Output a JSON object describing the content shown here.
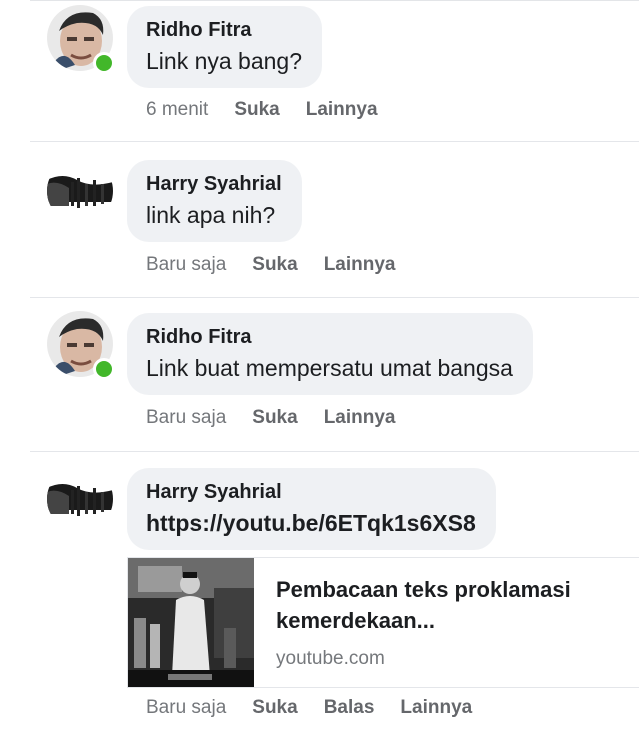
{
  "comments": [
    {
      "author": "Ridho Fitra",
      "text": "Link nya bang?",
      "time": "6 menit",
      "actions": [
        "Suka",
        "Lainnya"
      ],
      "avatar": "face-avatar",
      "online": true
    },
    {
      "author": "Harry Syahrial",
      "text": "link apa nih?",
      "time": "Baru saja",
      "actions": [
        "Suka",
        "Lainnya"
      ],
      "avatar": "landscape-avatar",
      "online": false
    },
    {
      "author": "Ridho Fitra",
      "text": "Link buat mempersatu umat bangsa",
      "time": "Baru saja",
      "actions": [
        "Suka",
        "Lainnya"
      ],
      "avatar": "face-avatar",
      "online": true
    },
    {
      "author": "Harry Syahrial",
      "text": "https://youtu.be/6ETqk1s6XS8",
      "time": "Baru saja",
      "actions": [
        "Suka",
        "Balas",
        "Lainnya"
      ],
      "avatar": "landscape-avatar",
      "online": false
    }
  ],
  "link_preview": {
    "title": "Pembacaan teks proklamasi kemerdekaan...",
    "domain": "youtube.com",
    "thumbnail": "black-and-white-video-thumbnail"
  },
  "colors": {
    "bubble_bg": "#eff1f4",
    "online_dot": "#42b72a",
    "meta_text": "#65676b"
  }
}
